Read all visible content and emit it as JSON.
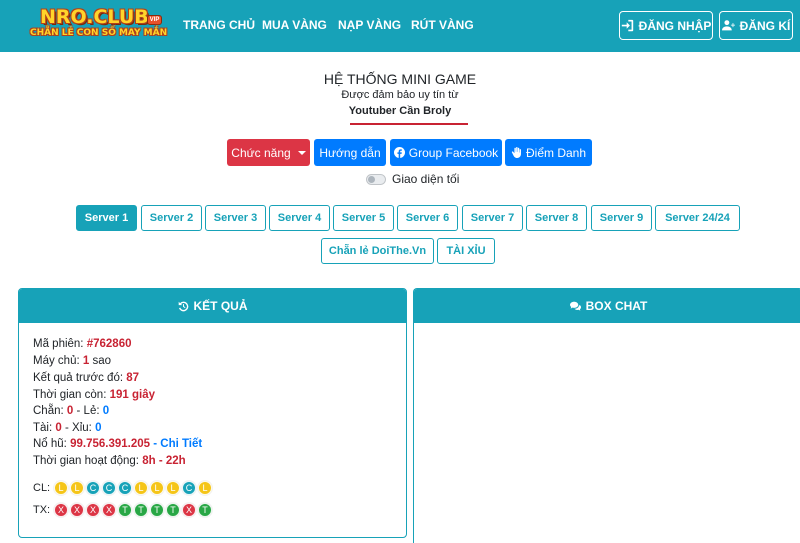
{
  "logo": {
    "main": "NRO.CLUB",
    "sub": "CHẴN LẺ CON SỐ MAY MẮN",
    "tag": "VIP"
  },
  "nav": {
    "links": [
      "TRANG CHỦ",
      "MUA VÀNG",
      "NẠP VÀNG",
      "RÚT VÀNG"
    ],
    "login_label": "ĐĂNG NHẬP",
    "register_label": "ĐĂNG KÍ"
  },
  "header": {
    "title": "HỆ THỐNG MINI GAME",
    "subtitle": "Được đảm bảo uy tín từ",
    "youtuber": "Youtuber Cần Broly",
    "accent_color": "#c82333"
  },
  "actions": {
    "function_label": "Chức năng",
    "guide_label": "Hướng dẫn",
    "facebook_label": "Group Facebook",
    "checkin_label": "Điểm Danh"
  },
  "dark_mode": {
    "label": "Giao diện tối",
    "enabled": false
  },
  "servers": {
    "row1": [
      "Server 1",
      "Server 2",
      "Server 3",
      "Server 4",
      "Server 5",
      "Server 6",
      "Server 7",
      "Server 8",
      "Server 9",
      "Server 24/24"
    ],
    "row2": [
      "Chẵn lẻ DoiThe.Vn",
      "TÀI XỈU"
    ],
    "active": "Server 1"
  },
  "result_panel": {
    "title": "KẾT QUẢ",
    "session_label": "Mã phiên:",
    "session_value": "#762860",
    "server_label": "Máy chủ:",
    "server_value": "1",
    "server_unit": "sao",
    "prev_label": "Kết quả trước đó:",
    "prev_value": "87",
    "time_label": "Thời gian còn:",
    "time_value": "191 giây",
    "even_label": "Chẵn:",
    "even_value": "0",
    "sep": "-",
    "odd_label": "Lẻ:",
    "odd_value": "0",
    "tai_label": "Tài:",
    "tai_value": "0",
    "xiu_label": "Xỉu:",
    "xiu_value": "0",
    "jackpot_label": "Nổ hũ:",
    "jackpot_value": "99.756.391.205",
    "jackpot_link": "- Chi Tiết",
    "hours_label": "Thời gian hoạt động:",
    "hours_value": "8h - 22h",
    "cl_label": "CL:",
    "cl_history": [
      "L",
      "L",
      "C",
      "C",
      "C",
      "L",
      "L",
      "L",
      "C",
      "L"
    ],
    "tx_label": "TX:",
    "tx_history": [
      "X",
      "X",
      "X",
      "X",
      "T",
      "T",
      "T",
      "T",
      "X",
      "T"
    ]
  },
  "chat_panel": {
    "title": "BOX CHAT"
  },
  "colors": {
    "primary": "#17a2b8",
    "danger": "#dc3545",
    "blue": "#007bff",
    "yellow": "#f5c518",
    "green": "#28a745"
  }
}
